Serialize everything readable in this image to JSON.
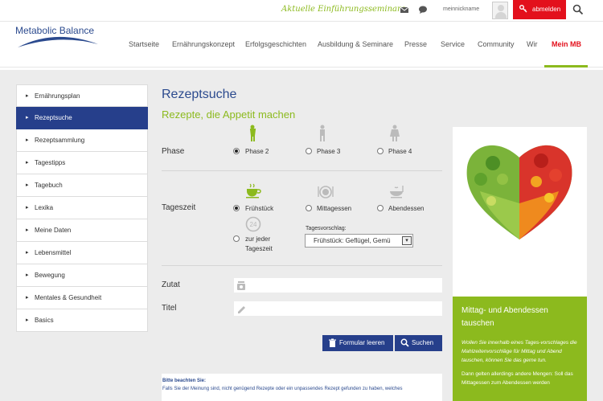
{
  "topbar": {
    "promo": "Aktuelle Einführungsseminare",
    "nickname": "meinnickname",
    "logout_label": "abmelden",
    "icons": [
      "mail-icon",
      "chat-icon",
      "avatar-icon",
      "key-icon",
      "search-icon"
    ]
  },
  "header": {
    "logo_text": "Metabolic Balance",
    "nav": [
      "Startseite",
      "Ernährungskonzept",
      "Erfolgsgeschichten",
      "Ausbildung & Seminare",
      "Presse",
      "Service",
      "Community",
      "Wir",
      "Mein MB"
    ],
    "active_nav": "Mein MB"
  },
  "sidebar": {
    "items": [
      "Ernährungsplan",
      "Rezeptsuche",
      "Rezeptsammlung",
      "Tagestipps",
      "Tagebuch",
      "Lexika",
      "Meine Daten",
      "Lebensmittel",
      "Bewegung",
      "Mentales & Gesundheit",
      "Basics"
    ],
    "active": "Rezeptsuche"
  },
  "main": {
    "title": "Rezeptsuche",
    "subtitle": "Rezepte, die Appetit machen",
    "phase": {
      "label": "Phase",
      "options": [
        "Phase 2",
        "Phase 3",
        "Phase 4"
      ],
      "selected": "Phase 2"
    },
    "tageszeit": {
      "label": "Tageszeit",
      "options": [
        "Frühstück",
        "Mittagessen",
        "Abendessen"
      ],
      "any_label_1": "zur jeder",
      "any_label_2": "Tageszeit",
      "selected": "Frühstück",
      "suggestion_hint": "Tagesvorschlag:",
      "suggestion_value": "Frühstück: Geflügel, Gemü",
      "icon_24": "24"
    },
    "zutat": {
      "label": "Zutat",
      "value": ""
    },
    "titel": {
      "label": "Titel",
      "value": ""
    },
    "buttons": {
      "clear": "Formular leeren",
      "search": "Suchen"
    },
    "note": {
      "heading": "Bitte beachten Sie:",
      "text": "Falls Sie der Meinung sind, nicht genügend Rezepte oder ein unpassendes Rezept gefunden zu haben, welches"
    }
  },
  "promo_box": {
    "title": "Mittag- und Abendessen tauschen",
    "text1": "Wollen Sie innerhalb eines Tages-vorschlages die Mahlzeitenvorschläge für Mittag und Abend tauschen, können Sie das gerne tun.",
    "text2": "Dann gelten allerdings andere Mengen: Soll das Mittagessen zum Abendessen werden"
  },
  "colors": {
    "brand_blue": "#263f8b",
    "brand_green": "#8cba1e",
    "logout_red": "#e3101c"
  }
}
